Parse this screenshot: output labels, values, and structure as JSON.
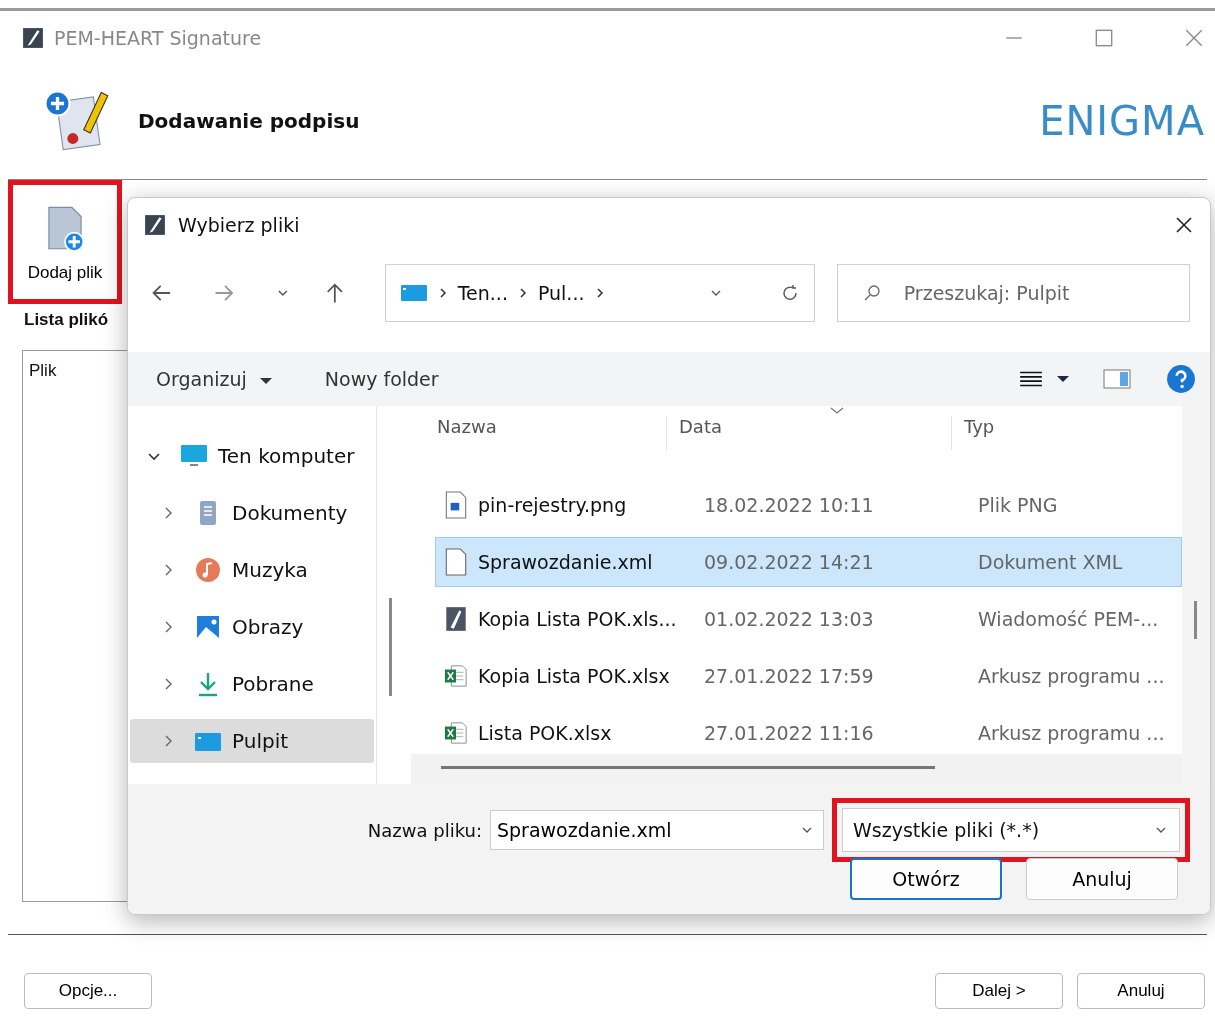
{
  "window": {
    "title": "PEM-HEART Signature",
    "heading": "Dodawanie podpisu",
    "logo": "ENIGMA"
  },
  "toolbar": {
    "add_file": "Dodaj plik",
    "highlighted": true
  },
  "files_panel": {
    "label": "Lista plikó",
    "column": "Plik"
  },
  "footer": {
    "options": "Opcje...",
    "next": "Dalej >",
    "cancel": "Anuluj"
  },
  "dialog": {
    "title": "Wybierz pliki",
    "breadcrumb": [
      "Ten...",
      "Pul..."
    ],
    "search": {
      "placeholder": "Przeszukaj: Pulpit"
    },
    "commands": {
      "organize": "Organizuj",
      "new_folder": "Nowy folder"
    },
    "nav": [
      {
        "label": "Ten komputer",
        "kind": "computer",
        "expanded": true,
        "selected": false,
        "children": [
          {
            "label": "Dokumenty",
            "kind": "documents",
            "expanded": false,
            "selected": false
          },
          {
            "label": "Muzyka",
            "kind": "music",
            "expanded": false,
            "selected": false
          },
          {
            "label": "Obrazy",
            "kind": "pictures",
            "expanded": false,
            "selected": false
          },
          {
            "label": "Pobrane",
            "kind": "downloads",
            "expanded": false,
            "selected": false
          },
          {
            "label": "Pulpit",
            "kind": "desktop",
            "expanded": false,
            "selected": true
          }
        ]
      }
    ],
    "columns": [
      "Nazwa",
      "Data",
      "Typ"
    ],
    "rows": [
      {
        "name": "pin-rejestry.png",
        "date": "18.02.2022 10:11",
        "type": "Plik PNG",
        "kind": "image",
        "selected": false
      },
      {
        "name": "Sprawozdanie.xml",
        "date": "09.02.2022 14:21",
        "type": "Dokument XML",
        "kind": "blank",
        "selected": true
      },
      {
        "name": "Kopia Lista POK.xls...",
        "date": "01.02.2022 13:03",
        "type": "Wiadomość PEM-...",
        "kind": "pem",
        "selected": false
      },
      {
        "name": "Kopia Lista POK.xlsx",
        "date": "27.01.2022 17:59",
        "type": "Arkusz programu ...",
        "kind": "excel",
        "selected": false
      },
      {
        "name": "Lista POK.xlsx",
        "date": "27.01.2022 11:16",
        "type": "Arkusz programu ...",
        "kind": "excel",
        "selected": false
      }
    ],
    "filename_label": "Nazwa pliku:",
    "filename": "Sprawozdanie.xml",
    "filter": "Wszystkie pliki (*.*)",
    "filter_highlighted": true,
    "open": "Otwórz",
    "cancel": "Anuluj"
  }
}
